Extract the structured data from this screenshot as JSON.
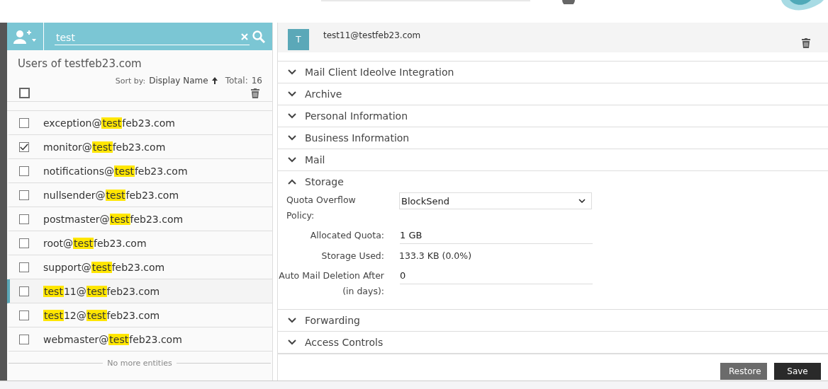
{
  "search": {
    "value": "test"
  },
  "list": {
    "title": "Users of testfeb23.com",
    "sort_label": "Sort by:",
    "sort_field": "Display Name",
    "total_label": "Total:",
    "total": "16",
    "all_checked": false,
    "rows": [
      {
        "parts": [
          {
            "text": "exception@",
            "match": false
          },
          {
            "text": "test",
            "match": true
          },
          {
            "text": "feb23.com",
            "match": false
          }
        ],
        "checked": false,
        "selected": false
      },
      {
        "parts": [
          {
            "text": "monitor@",
            "match": false
          },
          {
            "text": "test",
            "match": true
          },
          {
            "text": "feb23.com",
            "match": false
          }
        ],
        "checked": true,
        "selected": false
      },
      {
        "parts": [
          {
            "text": "notifications@",
            "match": false
          },
          {
            "text": "test",
            "match": true
          },
          {
            "text": "feb23.com",
            "match": false
          }
        ],
        "checked": false,
        "selected": false
      },
      {
        "parts": [
          {
            "text": "nullsender@",
            "match": false
          },
          {
            "text": "test",
            "match": true
          },
          {
            "text": "feb23.com",
            "match": false
          }
        ],
        "checked": false,
        "selected": false
      },
      {
        "parts": [
          {
            "text": "postmaster@",
            "match": false
          },
          {
            "text": "test",
            "match": true
          },
          {
            "text": "feb23.com",
            "match": false
          }
        ],
        "checked": false,
        "selected": false
      },
      {
        "parts": [
          {
            "text": "root@",
            "match": false
          },
          {
            "text": "test",
            "match": true
          },
          {
            "text": "feb23.com",
            "match": false
          }
        ],
        "checked": false,
        "selected": false
      },
      {
        "parts": [
          {
            "text": "support@",
            "match": false
          },
          {
            "text": "test",
            "match": true
          },
          {
            "text": "feb23.com",
            "match": false
          }
        ],
        "checked": false,
        "selected": false
      },
      {
        "parts": [
          {
            "text": "test",
            "match": true
          },
          {
            "text": "11@",
            "match": false
          },
          {
            "text": "test",
            "match": true
          },
          {
            "text": "feb23.com",
            "match": false
          }
        ],
        "checked": false,
        "selected": true
      },
      {
        "parts": [
          {
            "text": "test",
            "match": true
          },
          {
            "text": "12@",
            "match": false
          },
          {
            "text": "test",
            "match": true
          },
          {
            "text": "feb23.com",
            "match": false
          }
        ],
        "checked": false,
        "selected": false
      },
      {
        "parts": [
          {
            "text": "webmaster@",
            "match": false
          },
          {
            "text": "test",
            "match": true
          },
          {
            "text": "feb23.com",
            "match": false
          }
        ],
        "checked": false,
        "selected": false
      }
    ],
    "end_note": "No more entities"
  },
  "detail": {
    "avatar": "T",
    "email": "test11@testfeb23.com",
    "sections": [
      {
        "title": "Mail Client Ideolve Integration",
        "expanded": false
      },
      {
        "title": "Archive",
        "expanded": false
      },
      {
        "title": "Personal Information",
        "expanded": false
      },
      {
        "title": "Business Information",
        "expanded": false
      },
      {
        "title": "Mail",
        "expanded": false
      },
      {
        "title": "Storage",
        "expanded": true,
        "fields": [
          {
            "kind": "select",
            "label": "Quota Overflow Policy:",
            "value": "BlockSend"
          },
          {
            "kind": "input",
            "label": "Allocated Quota:",
            "value": "1 GB"
          },
          {
            "kind": "text",
            "label": "Storage Used:",
            "value": "133.3 KB (0.0%)"
          },
          {
            "kind": "input",
            "label": "Auto Mail Deletion After (in days):",
            "value": "0"
          }
        ]
      },
      {
        "title": "Forwarding",
        "expanded": false
      },
      {
        "title": "Access Controls",
        "expanded": false
      }
    ],
    "buttons": [
      {
        "label": "Restore",
        "kind": "secondary"
      },
      {
        "label": "Save",
        "kind": "primary"
      }
    ]
  }
}
